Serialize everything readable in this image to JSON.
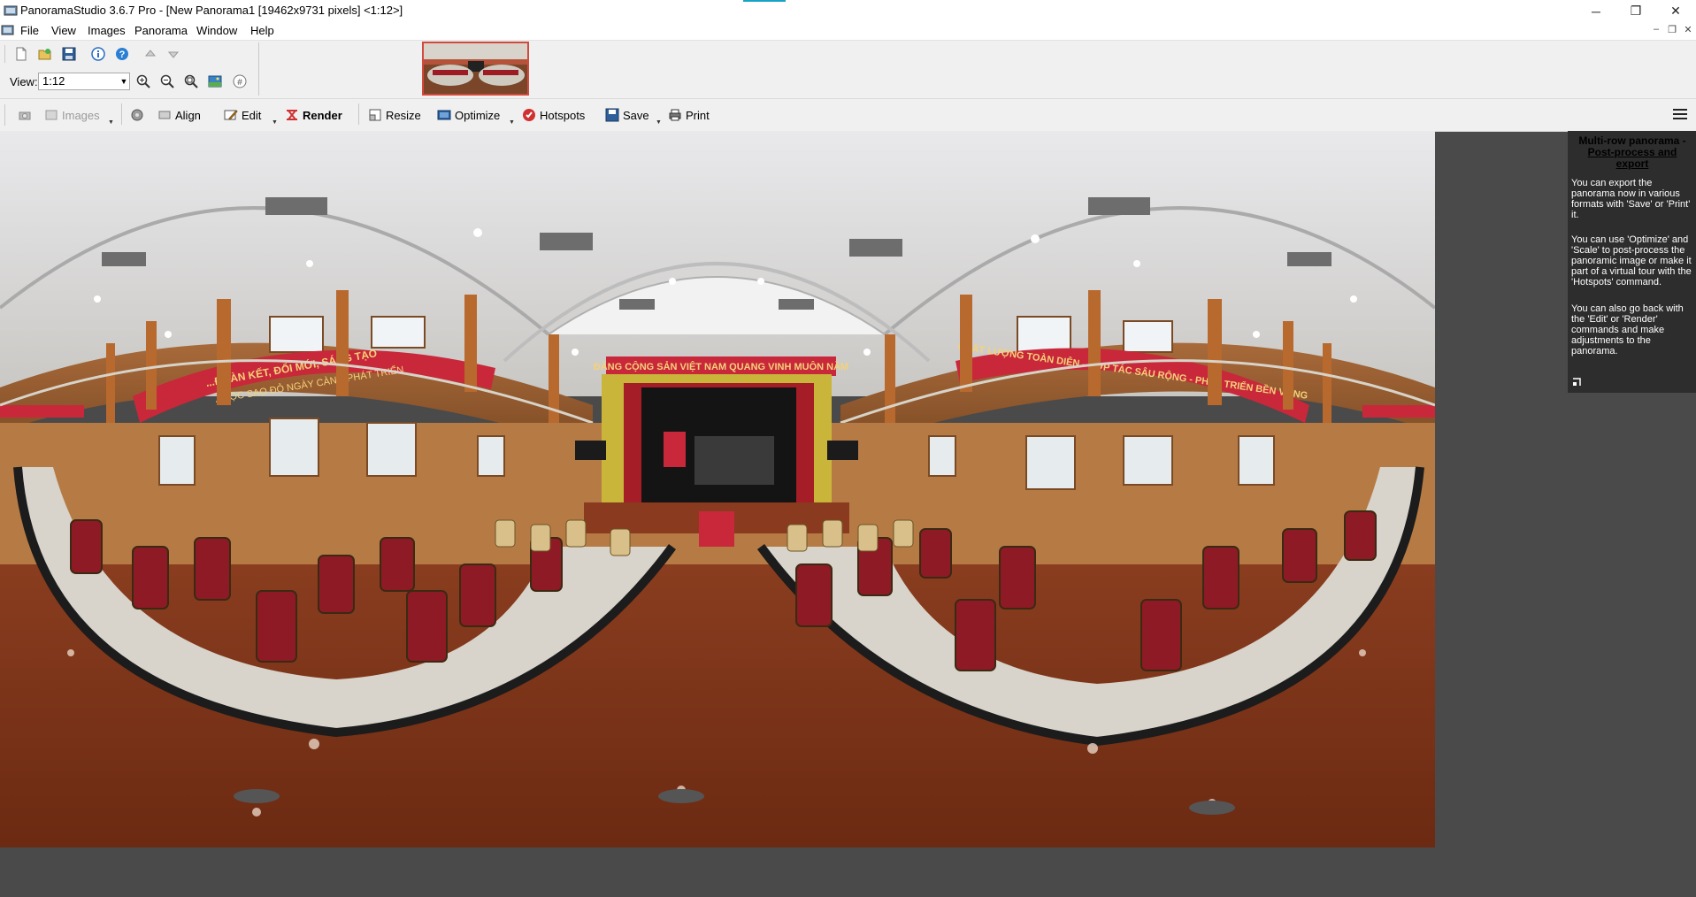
{
  "window": {
    "title": "PanoramaStudio 3.6.7 Pro - [New Panorama1 [19462x9731 pixels] <1:12>]",
    "controls": {
      "minimize": "─",
      "restore": "❐",
      "close": "✕"
    },
    "mdi_controls": {
      "minimize": "–",
      "restore": "❐",
      "close": "✕"
    }
  },
  "menu": [
    "File",
    "View",
    "Images",
    "Panorama",
    "Window",
    "Help"
  ],
  "toolbar": {
    "view_label": "View:",
    "view_value": "1:12"
  },
  "workflow": {
    "images": "Images",
    "align": "Align",
    "edit": "Edit",
    "render": "Render",
    "resize": "Resize",
    "optimize": "Optimize",
    "hotspots": "Hotspots",
    "save": "Save",
    "print": "Print"
  },
  "panel": {
    "title_line1": "Multi-row panorama -",
    "title_line2": "Post-process and export",
    "p1": "You can export the panorama now in various formats with 'Save' or 'Print' it.",
    "p2": "You can use 'Optimize' and 'Scale' to post-process the panoramic image or make it part of a virtual tour with the 'Hotspots' command.",
    "p3": "You can also go back with the 'Edit' or 'Render' commands and make adjustments to the panorama."
  },
  "pano": {
    "banner_left": "...ĐOÀN KẾT, ĐỔI MỚI, SÁNG TẠO",
    "banner_left2": "...HỌC SAO ĐỎ NGÀY CÀNG PHÁT TRIỂN",
    "banner_center": "ĐẢNG CỘNG SẢN VIỆT NAM QUANG VINH MUÔN NĂM",
    "banner_right": "CHẤT LƯỢNG TOÀN DIỆN - HỢP TÁC SÂU RỘNG - PHÁT TRIỂN BỀN VỮNG"
  }
}
